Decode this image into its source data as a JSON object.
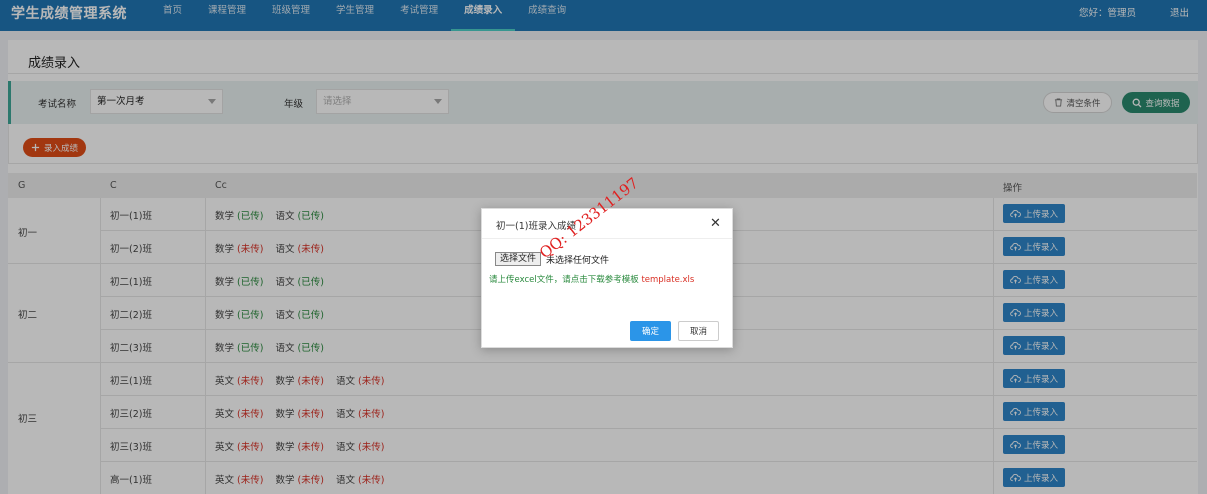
{
  "app": {
    "title": "学生成绩管理系统",
    "nav": [
      "首页",
      "课程管理",
      "班级管理",
      "学生管理",
      "考试管理",
      "成绩录入",
      "成绩查询"
    ],
    "active_nav": "成绩录入",
    "greeting": "您好：管理员",
    "logout": "退出"
  },
  "page": {
    "title": "成绩录入",
    "filter": {
      "exam_label": "考试名称",
      "exam_value": "第一次月考",
      "grade_label": "年级",
      "grade_placeholder": "请选择",
      "clear_label": "清空条件",
      "query_label": "查询数据"
    },
    "add_label": "录入成绩"
  },
  "table": {
    "headers": [
      "G",
      "C",
      "Cc",
      "操作"
    ],
    "grades": [
      "初一",
      "初二",
      "初三"
    ],
    "upload_label": "上传录入",
    "rows": [
      {
        "cls": "初一(1)班",
        "subjects": [
          {
            "name": "数学",
            "status": "(已传)"
          },
          {
            "name": "语文",
            "status": "(已传)"
          }
        ]
      },
      {
        "cls": "初一(2)班",
        "subjects": [
          {
            "name": "数学",
            "status": "(未传)"
          },
          {
            "name": "语文",
            "status": "(未传)"
          }
        ]
      },
      {
        "cls": "初二(1)班",
        "subjects": [
          {
            "name": "数学",
            "status": "(已传)"
          },
          {
            "name": "语文",
            "status": "(已传)"
          }
        ]
      },
      {
        "cls": "初二(2)班",
        "subjects": [
          {
            "name": "数学",
            "status": "(已传)"
          },
          {
            "name": "语文",
            "status": "(已传)"
          }
        ]
      },
      {
        "cls": "初二(3)班",
        "subjects": [
          {
            "name": "数学",
            "status": "(已传)"
          },
          {
            "name": "语文",
            "status": "(已传)"
          }
        ]
      },
      {
        "cls": "初三(1)班",
        "subjects": [
          {
            "name": "英文",
            "status": "(未传)"
          },
          {
            "name": "数学",
            "status": "(未传)"
          },
          {
            "name": "语文",
            "status": "(未传)"
          }
        ]
      },
      {
        "cls": "初三(2)班",
        "subjects": [
          {
            "name": "英文",
            "status": "(未传)"
          },
          {
            "name": "数学",
            "status": "(未传)"
          },
          {
            "name": "语文",
            "status": "(未传)"
          }
        ]
      },
      {
        "cls": "初三(3)班",
        "subjects": [
          {
            "name": "英文",
            "status": "(未传)"
          },
          {
            "name": "数学",
            "status": "(未传)"
          },
          {
            "name": "语文",
            "status": "(未传)"
          }
        ]
      },
      {
        "cls": "高一(1)班",
        "subjects": [
          {
            "name": "英文",
            "status": "(未传)"
          },
          {
            "name": "数学",
            "status": "(未传)"
          },
          {
            "name": "语文",
            "status": "(未传)"
          }
        ]
      }
    ]
  },
  "modal": {
    "title": "初一(1)班录入成绩",
    "file_button": "选择文件",
    "file_status": "未选择任何文件",
    "hint_text": "请上传excel文件，请点击下载参考模板",
    "template_link": "template.xls",
    "ok_label": "确定",
    "cancel_label": "取消"
  },
  "watermark": "QQ: 123311197"
}
